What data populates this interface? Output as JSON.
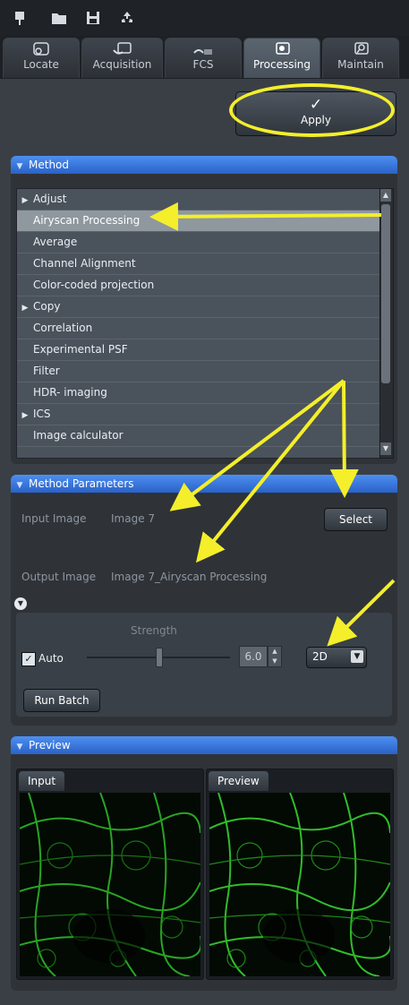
{
  "toolbar": {
    "icons": [
      "pin-icon",
      "open-folder-icon",
      "save-icon",
      "recycle-icon"
    ]
  },
  "tabs": [
    {
      "label": "Locate",
      "icon": "locate-icon",
      "active": false
    },
    {
      "label": "Acquisition",
      "icon": "acquisition-icon",
      "active": false
    },
    {
      "label": "FCS",
      "icon": "fcs-icon",
      "active": false
    },
    {
      "label": "Processing",
      "icon": "processing-gear-icon",
      "active": true
    },
    {
      "label": "Maintain",
      "icon": "maintain-icon",
      "active": false
    }
  ],
  "apply": {
    "check": "✓",
    "label": "Apply"
  },
  "method": {
    "title": "Method",
    "items": [
      {
        "label": "Adjust",
        "expandable": true
      },
      {
        "label": "Airyscan Processing",
        "expandable": false,
        "selected": true
      },
      {
        "label": "Average",
        "expandable": false
      },
      {
        "label": "Channel Alignment",
        "expandable": false
      },
      {
        "label": "Color-coded projection",
        "expandable": false
      },
      {
        "label": "Copy",
        "expandable": true
      },
      {
        "label": "Correlation",
        "expandable": false
      },
      {
        "label": "Experimental PSF",
        "expandable": false
      },
      {
        "label": "Filter",
        "expandable": false
      },
      {
        "label": "HDR- imaging",
        "expandable": false
      },
      {
        "label": "ICS",
        "expandable": true
      },
      {
        "label": "Image calculator",
        "expandable": false
      }
    ]
  },
  "params": {
    "title": "Method Parameters",
    "input_label": "Input Image",
    "input_value": "Image 7",
    "select_label": "Select",
    "output_label": "Output Image",
    "output_value": "Image 7_Airyscan Processing",
    "strength_label": "Strength",
    "auto_label": "Auto",
    "auto_checked": true,
    "strength_value": "6.0",
    "mode_value": "2D",
    "run_batch_label": "Run Batch"
  },
  "preview": {
    "title": "Preview",
    "input_tab": "Input",
    "preview_tab": "Preview"
  },
  "colors": {
    "annotation": "#f4ef2a",
    "panel_header": "#2a62c8",
    "selected_row": "#8f979f",
    "preview_green": "#2fbf2a"
  }
}
